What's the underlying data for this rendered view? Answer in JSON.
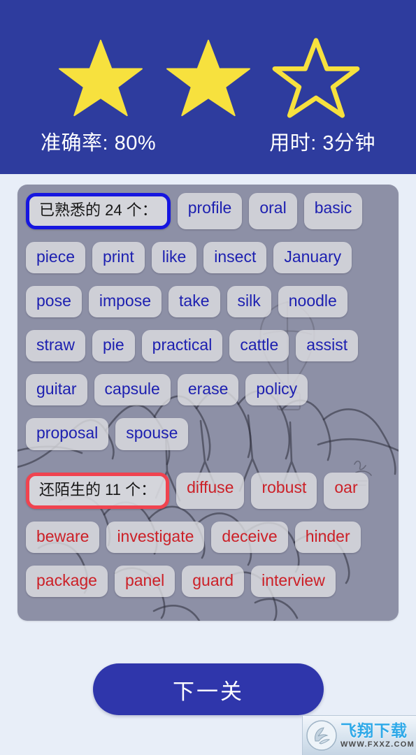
{
  "header": {
    "stars": {
      "total": 3,
      "filled": 2,
      "fill_color": "#f7e13e",
      "outline_color": "#f7e13e"
    },
    "background_color": "#2e3c9e",
    "accuracy_label": "准确率: 80%",
    "time_label": "用时: 3分钟"
  },
  "panel": {
    "background_color": "#8d90a6",
    "known": {
      "label": "已熟悉的 24 个：",
      "count": 24,
      "border_color": "#1616e0",
      "text_color": "#1c1fb0",
      "rows": [
        [
          "profile",
          "oral",
          "basic"
        ],
        [
          "piece",
          "print",
          "like",
          "insect",
          "January"
        ],
        [
          "pose",
          "impose",
          "take",
          "silk",
          "noodle"
        ],
        [
          "straw",
          "pie",
          "practical",
          "cattle",
          "assist"
        ],
        [
          "guitar",
          "capsule",
          "erase",
          "policy"
        ],
        [
          "proposal",
          "spouse"
        ]
      ]
    },
    "unknown": {
      "label": "还陌生的 11 个：",
      "count": 11,
      "border_color": "#f0434f",
      "text_color": "#cc2027",
      "rows": [
        [
          "diffuse",
          "robust",
          "oar"
        ],
        [
          "beware",
          "investigate",
          "deceive",
          "hinder"
        ],
        [
          "package",
          "panel",
          "guard",
          "interview"
        ]
      ]
    }
  },
  "footer": {
    "next_button_label": "下一关",
    "next_button_color": "#2f36ab"
  },
  "watermark": {
    "title": "飞翔下载",
    "url": "WWW.FXXZ.COM"
  }
}
